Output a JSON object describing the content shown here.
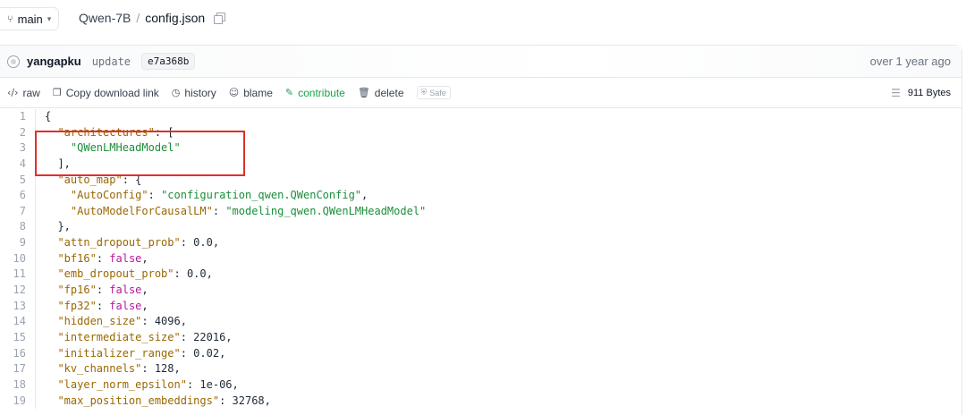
{
  "breadcrumb": {
    "branch": "main",
    "repo": "Qwen-7B",
    "separator": "/",
    "file": "config.json"
  },
  "commit": {
    "author": "yangapku",
    "message": "update",
    "hash": "e7a368b",
    "time": "over 1 year ago"
  },
  "actions": {
    "raw": "raw",
    "copy_link": "Copy download link",
    "history": "history",
    "blame": "blame",
    "contribute": "contribute",
    "delete": "delete",
    "safe": "Safe",
    "size": "911 Bytes"
  },
  "colors": {
    "key": "#9a6700",
    "string": "#1a8f3a",
    "boolean": "#b5179e",
    "highlight": "#e0302a",
    "accent_green": "#16a34a"
  },
  "code_lines": [
    [
      {
        "t": "p",
        "v": "{"
      }
    ],
    [
      {
        "t": "p",
        "v": "  "
      },
      {
        "t": "k",
        "v": "\"architectures\""
      },
      {
        "t": "p",
        "v": ": ["
      }
    ],
    [
      {
        "t": "p",
        "v": "    "
      },
      {
        "t": "s",
        "v": "\"QWenLMHeadModel\""
      }
    ],
    [
      {
        "t": "p",
        "v": "  ],"
      }
    ],
    [
      {
        "t": "p",
        "v": "  "
      },
      {
        "t": "k",
        "v": "\"auto_map\""
      },
      {
        "t": "p",
        "v": ": {"
      }
    ],
    [
      {
        "t": "p",
        "v": "    "
      },
      {
        "t": "k",
        "v": "\"AutoConfig\""
      },
      {
        "t": "p",
        "v": ": "
      },
      {
        "t": "s",
        "v": "\"configuration_qwen.QWenConfig\""
      },
      {
        "t": "p",
        "v": ","
      }
    ],
    [
      {
        "t": "p",
        "v": "    "
      },
      {
        "t": "k",
        "v": "\"AutoModelForCausalLM\""
      },
      {
        "t": "p",
        "v": ": "
      },
      {
        "t": "s",
        "v": "\"modeling_qwen.QWenLMHeadModel\""
      }
    ],
    [
      {
        "t": "p",
        "v": "  },"
      }
    ],
    [
      {
        "t": "p",
        "v": "  "
      },
      {
        "t": "k",
        "v": "\"attn_dropout_prob\""
      },
      {
        "t": "p",
        "v": ": 0.0,"
      }
    ],
    [
      {
        "t": "p",
        "v": "  "
      },
      {
        "t": "k",
        "v": "\"bf16\""
      },
      {
        "t": "p",
        "v": ": "
      },
      {
        "t": "b",
        "v": "false"
      },
      {
        "t": "p",
        "v": ","
      }
    ],
    [
      {
        "t": "p",
        "v": "  "
      },
      {
        "t": "k",
        "v": "\"emb_dropout_prob\""
      },
      {
        "t": "p",
        "v": ": 0.0,"
      }
    ],
    [
      {
        "t": "p",
        "v": "  "
      },
      {
        "t": "k",
        "v": "\"fp16\""
      },
      {
        "t": "p",
        "v": ": "
      },
      {
        "t": "b",
        "v": "false"
      },
      {
        "t": "p",
        "v": ","
      }
    ],
    [
      {
        "t": "p",
        "v": "  "
      },
      {
        "t": "k",
        "v": "\"fp32\""
      },
      {
        "t": "p",
        "v": ": "
      },
      {
        "t": "b",
        "v": "false"
      },
      {
        "t": "p",
        "v": ","
      }
    ],
    [
      {
        "t": "p",
        "v": "  "
      },
      {
        "t": "k",
        "v": "\"hidden_size\""
      },
      {
        "t": "p",
        "v": ": 4096,"
      }
    ],
    [
      {
        "t": "p",
        "v": "  "
      },
      {
        "t": "k",
        "v": "\"intermediate_size\""
      },
      {
        "t": "p",
        "v": ": 22016,"
      }
    ],
    [
      {
        "t": "p",
        "v": "  "
      },
      {
        "t": "k",
        "v": "\"initializer_range\""
      },
      {
        "t": "p",
        "v": ": 0.02,"
      }
    ],
    [
      {
        "t": "p",
        "v": "  "
      },
      {
        "t": "k",
        "v": "\"kv_channels\""
      },
      {
        "t": "p",
        "v": ": 128,"
      }
    ],
    [
      {
        "t": "p",
        "v": "  "
      },
      {
        "t": "k",
        "v": "\"layer_norm_epsilon\""
      },
      {
        "t": "p",
        "v": ": 1e-06,"
      }
    ],
    [
      {
        "t": "p",
        "v": "  "
      },
      {
        "t": "k",
        "v": "\"max_position_embeddings\""
      },
      {
        "t": "p",
        "v": ": 32768,"
      }
    ]
  ]
}
